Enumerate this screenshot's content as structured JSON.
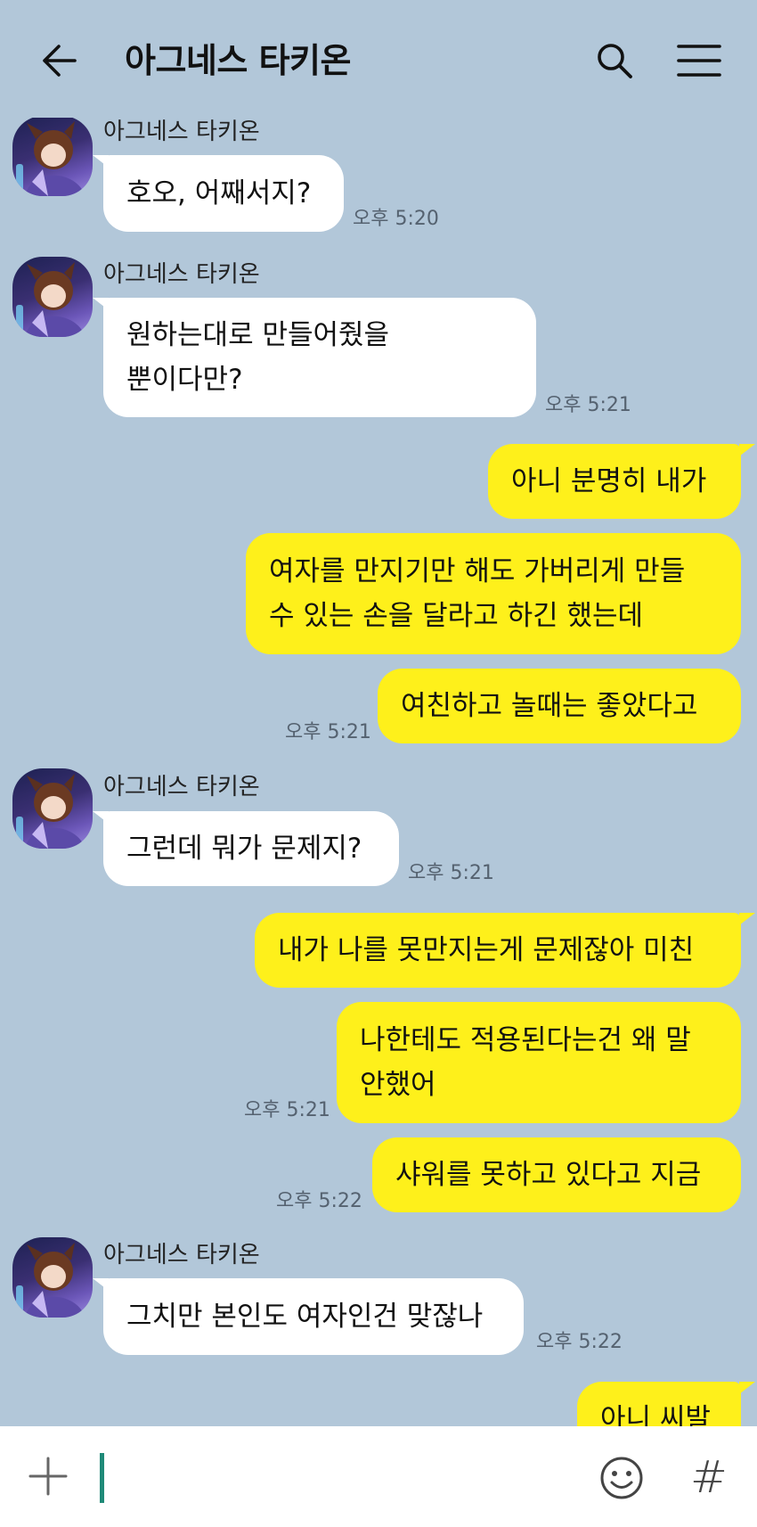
{
  "header": {
    "title": "아그네스 타키온",
    "back_icon": "arrow-left-icon",
    "search_icon": "search-icon",
    "menu_icon": "hamburger-menu-icon"
  },
  "colors": {
    "background": "#b2c7d9",
    "outgoing_bubble": "#fef01b",
    "incoming_bubble": "#ffffff",
    "caret": "#1f8a78"
  },
  "messages": [
    {
      "sender": "아그네스 타키온",
      "text": "호오, 어째서지?",
      "time": "오후 5:20"
    },
    {
      "sender": "아그네스 타키온",
      "lines": [
        "원하는대로 만들어줬을",
        "뿐이다만?"
      ],
      "time": "오후 5:21"
    },
    {
      "text": "아니 분명히 내가"
    },
    {
      "lines": [
        "여자를 만지기만 해도 가버리게 만들",
        "수 있는 손을 달라고 하긴 했는데"
      ]
    },
    {
      "text": "여친하고 놀때는 좋았다고",
      "time": "오후 5:21"
    },
    {
      "sender": "아그네스 타키온",
      "text": "그런데 뭐가 문제지?",
      "time": "오후 5:21"
    },
    {
      "text": "내가 나를 못만지는게 문제잖아 미친"
    },
    {
      "lines": [
        "나한테도 적용된다는건 왜 말",
        "안했어"
      ],
      "time": "오후 5:21"
    },
    {
      "text": "샤워를 못하고 있다고 지금",
      "time": "오후 5:22"
    },
    {
      "sender": "아그네스 타키온",
      "text": "그치만 본인도 여자인건 맞잖나",
      "time": "오후 5:22"
    },
    {
      "text": "아니 씨발"
    }
  ],
  "input_bar": {
    "plus_icon": "plus-icon",
    "emoji_icon": "emoji-smile-icon",
    "hash_label": "#",
    "value": "",
    "placeholder": ""
  }
}
